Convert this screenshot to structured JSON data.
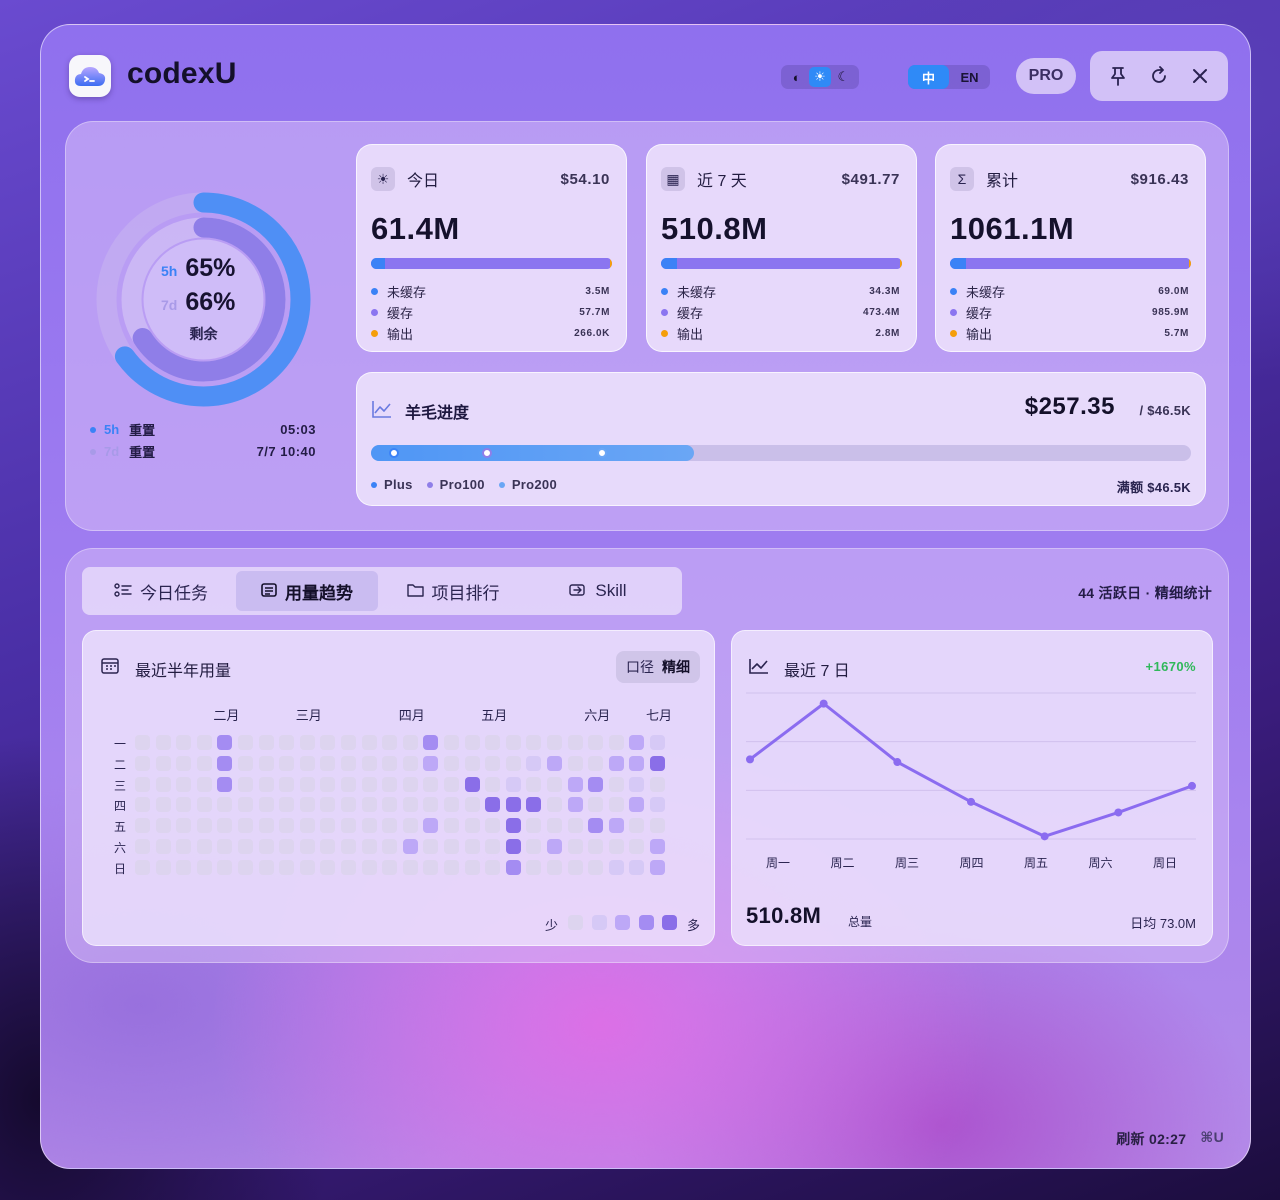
{
  "app": {
    "title": "codexU"
  },
  "header": {
    "theme_icons": [
      "contrast-icon",
      "sun-icon",
      "moon-icon"
    ],
    "lang": [
      "中",
      "EN"
    ],
    "pro_label": "PRO",
    "controls": [
      "pin-icon",
      "refresh-icon",
      "close-icon"
    ]
  },
  "quota": {
    "rows": [
      {
        "tag": "5h",
        "value": "65%",
        "percent": 65,
        "color": "#3b82f6"
      },
      {
        "tag": "7d",
        "value": "66%",
        "percent": 66,
        "color": "#8f7ee8"
      }
    ],
    "remain_label": "剩余",
    "resets": [
      {
        "tag": "5h",
        "label": "重置",
        "time": "05:03",
        "color": "#3b82f6"
      },
      {
        "tag": "7d",
        "label": "重置",
        "time": "7/7 10:40",
        "color": "#a89ae8"
      }
    ]
  },
  "stats": [
    {
      "icon": "sun-icon",
      "label": "今日",
      "cost": "$54.10",
      "total": "61.4M",
      "items": [
        {
          "label": "未缓存",
          "value": "3.5M",
          "color": "#3b82f6",
          "amount": 3.5
        },
        {
          "label": "缓存",
          "value": "57.7M",
          "color": "#8b75f0",
          "amount": 57.7
        },
        {
          "label": "输出",
          "value": "266.0K",
          "color": "#f59e0b",
          "amount": 0.266
        }
      ]
    },
    {
      "icon": "calendar-icon",
      "label": "近 7 天",
      "cost": "$491.77",
      "total": "510.8M",
      "items": [
        {
          "label": "未缓存",
          "value": "34.3M",
          "color": "#3b82f6",
          "amount": 34.3
        },
        {
          "label": "缓存",
          "value": "473.4M",
          "color": "#8b75f0",
          "amount": 473.4
        },
        {
          "label": "输出",
          "value": "2.8M",
          "color": "#f59e0b",
          "amount": 2.8
        }
      ]
    },
    {
      "icon": "sigma-icon",
      "label": "累计",
      "cost": "$916.43",
      "total": "1061.1M",
      "items": [
        {
          "label": "未缓存",
          "value": "69.0M",
          "color": "#3b82f6",
          "amount": 69.0
        },
        {
          "label": "缓存",
          "value": "985.9M",
          "color": "#8b75f0",
          "amount": 985.9
        },
        {
          "label": "输出",
          "value": "5.7M",
          "color": "#f59e0b",
          "amount": 5.7
        }
      ]
    }
  ],
  "progress": {
    "title": "羊毛进度",
    "amount": "$257.35",
    "total": "/ $46.5K",
    "fill_fraction": 0.394,
    "markers": [
      {
        "label": "Plus",
        "fraction": 0.028,
        "color": "#3b82f6"
      },
      {
        "label": "Pro100",
        "fraction": 0.141,
        "color": "#8f7ee8"
      },
      {
        "label": "Pro200",
        "fraction": 0.282,
        "color": "#6aa6f5"
      }
    ],
    "cap_label": "满额 $46.5K"
  },
  "tabs": [
    {
      "label": "今日任务",
      "icon": "list-icon",
      "active": false
    },
    {
      "label": "用量趋势",
      "icon": "chart-box-icon",
      "active": true
    },
    {
      "label": "项目排行",
      "icon": "folder-icon",
      "active": false
    },
    {
      "label": "Skill",
      "icon": "skill-icon",
      "active": false
    }
  ],
  "active_days": "44 活跃日 · 精细统计",
  "heatmap": {
    "title": "最近半年用量",
    "toggle_label": "口径",
    "toggle_value": "精细",
    "months": [
      "二月",
      "三月",
      "四月",
      "五月",
      "六月",
      "七月"
    ],
    "month_cols": [
      4,
      8,
      13,
      17,
      22,
      25
    ],
    "days": [
      "一",
      "二",
      "三",
      "四",
      "五",
      "六",
      "日"
    ],
    "levels": [
      "00003000000000300000000021",
      "00003000000000200001200224",
      "00003000000000004010023010",
      "00000000000000000444020021",
      "00000000000000200040003200",
      "00000000000002000040200002",
      "00000000000000000030000112"
    ],
    "scale_low": "少",
    "scale_high": "多",
    "colors": [
      "#ddd4ef",
      "#d6c9f6",
      "#bda8f7",
      "#a48cf2",
      "#8a6ee8"
    ]
  },
  "chart_data": {
    "type": "line",
    "title": "最近 7 日",
    "categories": [
      "周一",
      "周二",
      "周三",
      "周四",
      "周五",
      "周六",
      "周日"
    ],
    "values": [
      60,
      102,
      58,
      28,
      2,
      20,
      40
    ],
    "ylim": [
      0,
      110
    ],
    "color": "#8b6cf0",
    "grid": true,
    "delta": "+1670%",
    "total": "510.8M",
    "total_label": "总量",
    "avg": "日均 73.0M"
  },
  "footer": {
    "refresh": "刷新 02:27",
    "shortcut": "⌘U"
  }
}
